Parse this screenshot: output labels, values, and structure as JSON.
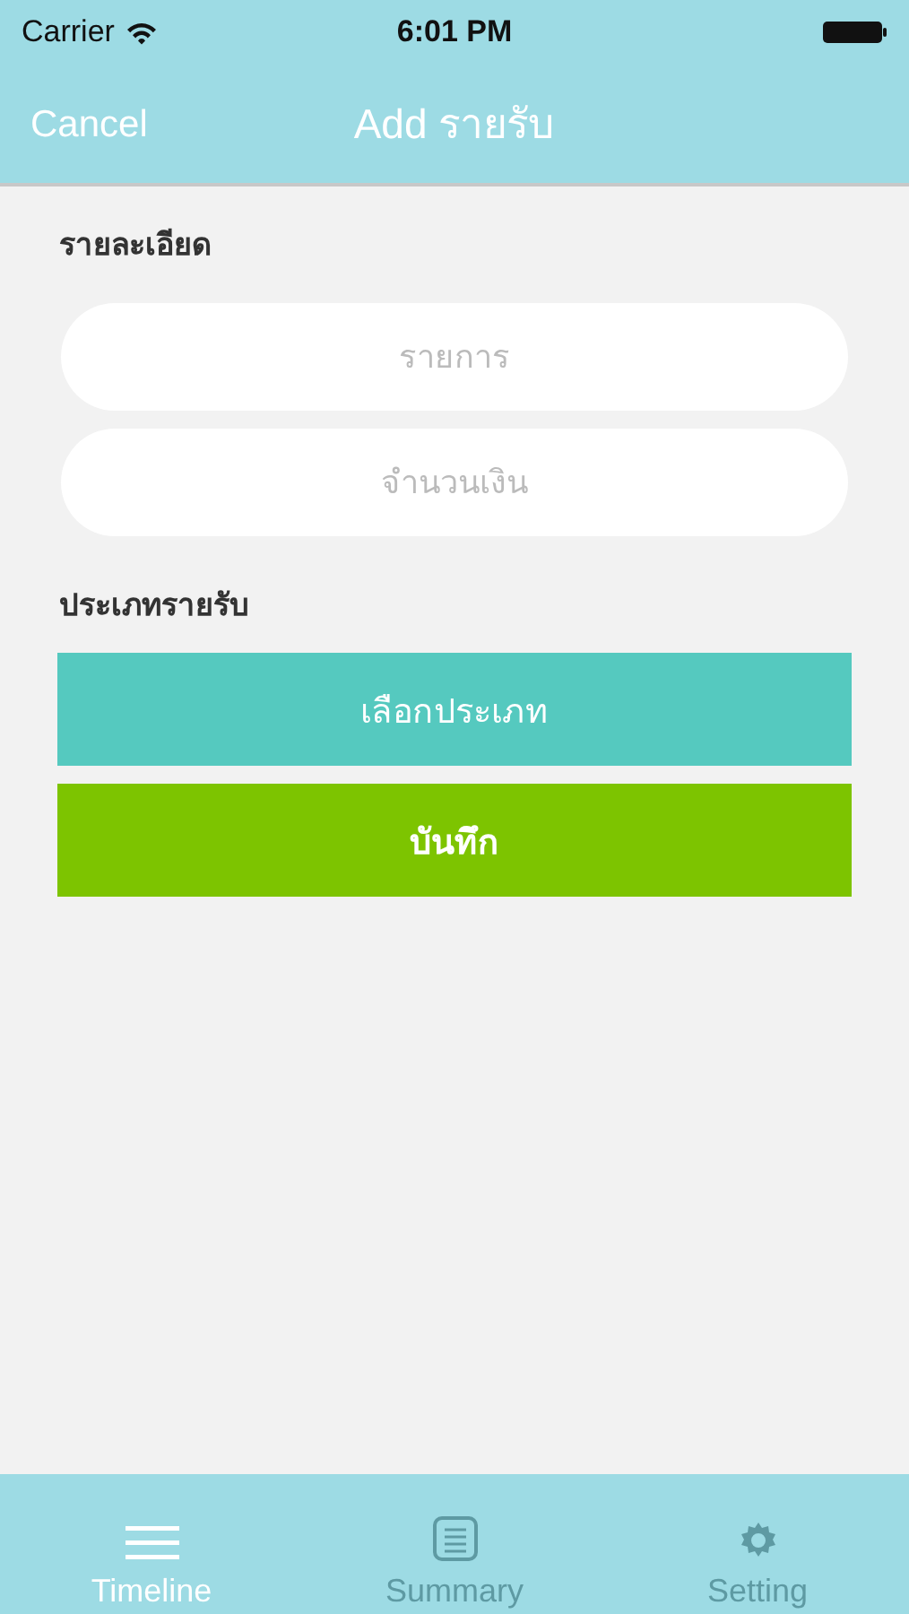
{
  "status_bar": {
    "carrier": "Carrier",
    "time": "6:01 PM"
  },
  "nav": {
    "cancel": "Cancel",
    "title": "Add รายรับ"
  },
  "details_label": "รายละเอียด",
  "fields": [
    {
      "placeholder": "รายการ"
    },
    {
      "placeholder": "จำนวนเงิน"
    }
  ],
  "type_label": "ประเภทรายรับ",
  "buttons": [
    {
      "label": "เลือกประเภท",
      "kind": "select"
    },
    {
      "label": "บันทึก",
      "kind": "save"
    }
  ],
  "tabs": [
    {
      "label": "Timeline",
      "kind": "list",
      "selected": true
    },
    {
      "label": "Summary",
      "kind": "document",
      "selected": false
    },
    {
      "label": "Setting",
      "kind": "gear",
      "selected": false
    }
  ]
}
